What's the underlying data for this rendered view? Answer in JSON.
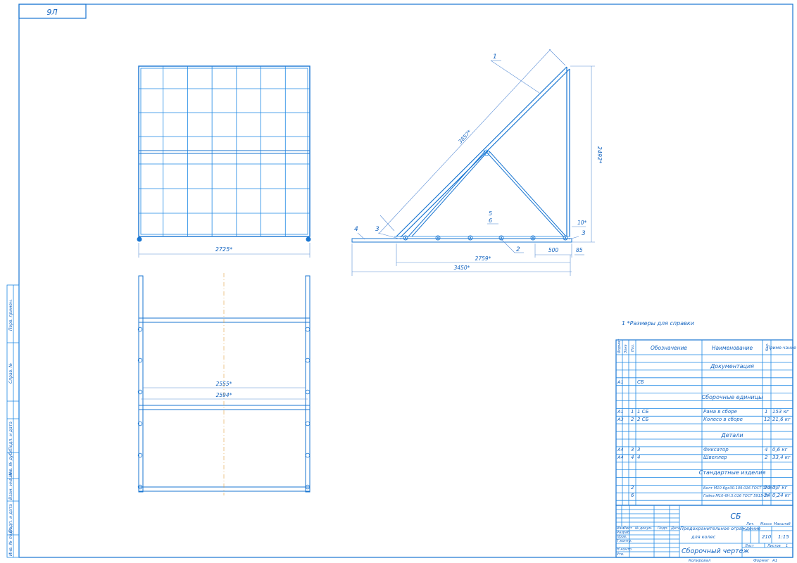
{
  "colors": {
    "line": "#1976d2",
    "text": "#1565c0",
    "axis": "#e0a040"
  },
  "corner_stamp": "9Л",
  "side_strip": [
    "Перв. примен.",
    "Справ. №",
    "Подп. и дата",
    "Инв. № дубл.",
    "Взам. инв. №",
    "Подп. и дата",
    "Инв. № подл."
  ],
  "front_view": {
    "dim_width": "2725*"
  },
  "side_view": {
    "dim_diag": "3857*",
    "dim_height": "2492*",
    "dim_angle": "10*",
    "dim_85": "85",
    "dim_500": "500",
    "dim_2759": "2759*",
    "dim_3450": "3450*",
    "callouts": [
      "1",
      "2",
      "3",
      "3",
      "4",
      "5",
      "6"
    ]
  },
  "top_view": {
    "dim_2555": "2555*",
    "dim_2594": "2594*"
  },
  "note": "1  *Размеры для справки",
  "spec": {
    "headers": {
      "format": "Формат",
      "zone": "Зона",
      "pos": "Поз.",
      "designation": "Обозначение",
      "name": "Наименование",
      "qty": "Кол.",
      "note": "Приме-чание"
    },
    "sections": {
      "documentation": "Документация",
      "assembly": "Сборочные единицы",
      "parts": "Детали",
      "standard": "Стандартные изделия"
    },
    "rows": {
      "doc": {
        "format": "А1",
        "pos": "",
        "designation": "СБ",
        "name": "",
        "qty": "",
        "note": ""
      },
      "r1": {
        "format": "А1",
        "pos": "1",
        "designation": "1 СБ",
        "name": "Рама в сборе",
        "qty": "1",
        "note": "153 кг"
      },
      "r2": {
        "format": "А3",
        "pos": "2",
        "designation": "2 СБ",
        "name": "Колесо в сборе",
        "qty": "12",
        "note": "21,6 кг"
      },
      "r3": {
        "format": "А4",
        "pos": "3",
        "designation": "3",
        "name": "Фиксатор",
        "qty": "4",
        "note": "0,6 кг"
      },
      "r4": {
        "format": "А4",
        "pos": "4",
        "designation": "4",
        "name": "Швеллер",
        "qty": "2",
        "note": "33,4 кг"
      },
      "r5": {
        "format": "",
        "pos": "2",
        "designation": "",
        "name": "Болт М10-6gх30.109.016 ГОСТ 7798-70",
        "qty": "24",
        "note": "0,7 кг"
      },
      "r6": {
        "format": "",
        "pos": "6",
        "designation": "",
        "name": "Гайка М10-6Н.5.016 ГОСТ 5915-70",
        "qty": "24",
        "note": "0,24 кг"
      }
    }
  },
  "title_block": {
    "code": "СБ",
    "title_line1": "Предохранительное ограждение",
    "title_line2": "для колес",
    "doc_type": "Сборочный чертеж",
    "lit_label": "Лит.",
    "mass_label": "Масса",
    "scale_label": "Масштаб",
    "mass": "210",
    "scale": "1:15",
    "sheet_label": "Лист",
    "sheets_label": "Листов",
    "sheets": "1",
    "rows": [
      "Изм.",
      "Лист",
      "№ докум.",
      "Подп.",
      "Дата"
    ],
    "roles": [
      "Разраб.",
      "Пров.",
      "Т.контр.",
      "",
      "Н.контр.",
      "Утв."
    ],
    "copied": "Копировал",
    "format_label": "Формат",
    "format": "А1"
  }
}
